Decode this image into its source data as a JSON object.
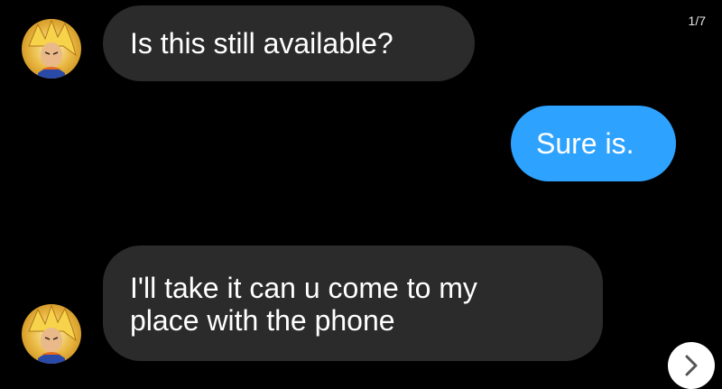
{
  "conversation": {
    "messages": [
      {
        "sender": "other",
        "text": "Is this still available?"
      },
      {
        "sender": "me",
        "text": "Sure is."
      },
      {
        "sender": "other",
        "text": "I'll take it can u come to my\nplace with the phone"
      }
    ]
  },
  "overlay": {
    "page_indicator": "1/7",
    "next_icon": "chevron-right-icon"
  },
  "colors": {
    "background": "#000000",
    "incoming_bubble": "#2b2b2b",
    "outgoing_bubble": "#2ea2ff",
    "text": "#ffffff"
  }
}
